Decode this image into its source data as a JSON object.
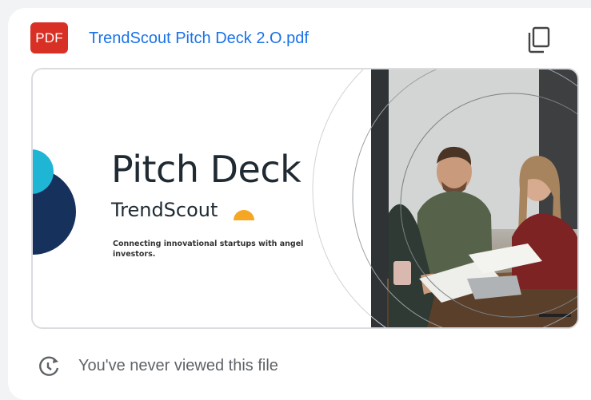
{
  "file": {
    "type_badge": "PDF",
    "name": "TrendScout Pitch Deck 2.O.pdf",
    "copy_icon": "copy-icon"
  },
  "preview": {
    "slide_title": "Pitch Deck",
    "slide_brand": "TrendScout",
    "slide_tagline": "Connecting innovational startups with angel investors.",
    "photo_description_icon": "team-meeting-photo"
  },
  "footer": {
    "icon": "history-icon",
    "status_text": "You've never viewed this file"
  },
  "colors": {
    "pdf_badge": "#d93025",
    "link": "#1a73e8",
    "navy": "#16325c",
    "cyan": "#1fb6d6",
    "accent_orange": "#f5a623",
    "muted_text": "#5f6368"
  }
}
